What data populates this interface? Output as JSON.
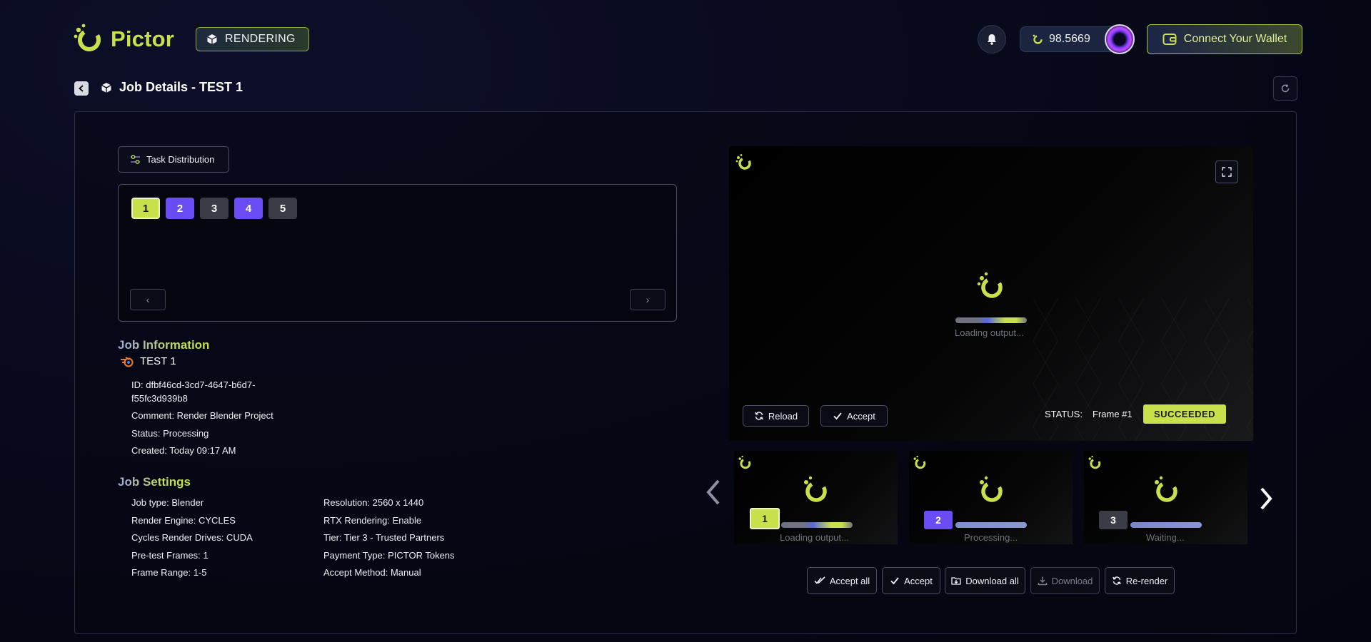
{
  "header": {
    "logo_text": "Pictor",
    "mode_badge": "RENDERING",
    "balance": "98.5669",
    "wallet_button": "Connect Your Wallet"
  },
  "page": {
    "title": "Job Details - TEST 1"
  },
  "tasks": {
    "button_label": "Task Distribution",
    "chips": [
      {
        "label": "1",
        "state": "selected"
      },
      {
        "label": "2",
        "state": "processing"
      },
      {
        "label": "3",
        "state": "waiting"
      },
      {
        "label": "4",
        "state": "processing"
      },
      {
        "label": "5",
        "state": "waiting"
      }
    ],
    "prev": "‹",
    "next": "›"
  },
  "job_info": {
    "heading": "Job Information",
    "name": "TEST 1",
    "id_line1": "ID: dfbf46cd-3cd7-4647-b6d7-",
    "id_line2": "f55fc3d939b8",
    "comment": "Comment: Render Blender Project",
    "status": "Status: Processing",
    "created": "Created: Today 09:17 AM"
  },
  "job_settings": {
    "heading": "Job Settings",
    "left": [
      "Job type: Blender",
      "Render Engine: CYCLES",
      "Cycles Render Drives: CUDA",
      "Pre-test Frames: 1",
      "Frame Range: 1-5"
    ],
    "right": [
      "Resolution: 2560 x 1440",
      "RTX Rendering: Enable",
      "Tier: Tier 3 - Trusted Partners",
      "Payment Type: PICTOR Tokens",
      "Accept Method: Manual"
    ]
  },
  "preview": {
    "loading_text": "Loading output...",
    "reload_label": "Reload",
    "accept_label": "Accept",
    "status_label": "STATUS:",
    "frame_label": "Frame #1",
    "status_badge": "SUCCEEDED"
  },
  "thumbnails": [
    {
      "chip": "1",
      "text": "Loading output...",
      "color": "#c8e04a"
    },
    {
      "chip": "2",
      "text": "Processing...",
      "color": "#6a4cf5"
    },
    {
      "chip": "3",
      "text": "Waiting...",
      "color": "#3a3d46"
    }
  ],
  "actions": {
    "accept_all": "Accept all",
    "accept": "Accept",
    "download_all": "Download all",
    "download": "Download",
    "rerender": "Re-render"
  },
  "colors": {
    "accent_lime": "#c8e04a",
    "accent_purple": "#6a4cf5",
    "background": "#070818"
  }
}
